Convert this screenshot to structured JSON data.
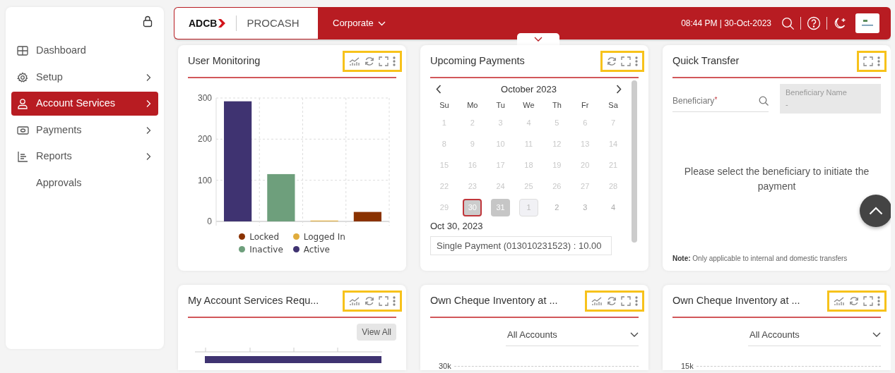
{
  "sidebar": {
    "items": [
      {
        "label": "Dashboard",
        "selected": false,
        "has_submenu": false
      },
      {
        "label": "Setup",
        "selected": false,
        "has_submenu": true
      },
      {
        "label": "Account Services",
        "selected": true,
        "has_submenu": true
      },
      {
        "label": "Payments",
        "selected": false,
        "has_submenu": true
      },
      {
        "label": "Reports",
        "selected": false,
        "has_submenu": true
      },
      {
        "label": "Approvals",
        "selected": false,
        "has_submenu": false
      }
    ]
  },
  "header": {
    "logo": "ADCB",
    "product": "PROCASH",
    "entity": "Corporate",
    "datetime": "08:44 PM | 30-Oct-2023"
  },
  "cards": [
    {
      "kind": "user_monitoring",
      "title": "User Monitoring",
      "highlighted": true,
      "chart_data": {
        "type": "bar",
        "stacked": true,
        "ylim": [
          0,
          300
        ],
        "yticks": [
          0,
          100,
          200,
          300
        ],
        "series": [
          {
            "name": "Locked",
            "color": "#8a3200",
            "values": [
              null,
              null,
              null,
              23
            ]
          },
          {
            "name": "Logged In",
            "color": "#e0ac3c",
            "values": [
              null,
              null,
              2,
              null
            ]
          },
          {
            "name": "Inactive",
            "color": "#6e9f7c",
            "values": [
              null,
              115,
              null,
              null
            ]
          },
          {
            "name": "Active",
            "color": "#3f3371",
            "values": [
              292,
              null,
              null,
              null
            ]
          }
        ]
      }
    },
    {
      "kind": "calendar",
      "title": "Upcoming Payments",
      "highlighted": true,
      "month": "October 2023",
      "weekdays": [
        "Su",
        "Mo",
        "Tu",
        "We",
        "Th",
        "Fr",
        "Sa"
      ],
      "days": [
        {
          "label": "1",
          "disabled": true,
          "selected": false,
          "marked": false,
          "focused": false
        },
        {
          "label": "2",
          "disabled": true,
          "selected": false,
          "marked": false,
          "focused": false
        },
        {
          "label": "3",
          "disabled": true,
          "selected": false,
          "marked": false,
          "focused": false
        },
        {
          "label": "4",
          "disabled": true,
          "selected": false,
          "marked": false,
          "focused": false
        },
        {
          "label": "5",
          "disabled": true,
          "selected": false,
          "marked": false,
          "focused": false
        },
        {
          "label": "6",
          "disabled": true,
          "selected": false,
          "marked": false,
          "focused": false
        },
        {
          "label": "7",
          "disabled": true,
          "selected": false,
          "marked": false,
          "focused": false
        },
        {
          "label": "8",
          "disabled": true,
          "selected": false,
          "marked": false,
          "focused": false
        },
        {
          "label": "9",
          "disabled": true,
          "selected": false,
          "marked": false,
          "focused": false
        },
        {
          "label": "10",
          "disabled": true,
          "selected": false,
          "marked": false,
          "focused": false
        },
        {
          "label": "11",
          "disabled": true,
          "selected": false,
          "marked": false,
          "focused": false
        },
        {
          "label": "12",
          "disabled": true,
          "selected": false,
          "marked": false,
          "focused": false
        },
        {
          "label": "13",
          "disabled": true,
          "selected": false,
          "marked": false,
          "focused": false
        },
        {
          "label": "14",
          "disabled": true,
          "selected": false,
          "marked": false,
          "focused": false
        },
        {
          "label": "15",
          "disabled": true,
          "selected": false,
          "marked": false,
          "focused": false
        },
        {
          "label": "16",
          "disabled": true,
          "selected": false,
          "marked": false,
          "focused": false
        },
        {
          "label": "17",
          "disabled": true,
          "selected": false,
          "marked": false,
          "focused": false
        },
        {
          "label": "18",
          "disabled": true,
          "selected": false,
          "marked": false,
          "focused": false
        },
        {
          "label": "19",
          "disabled": true,
          "selected": false,
          "marked": false,
          "focused": false
        },
        {
          "label": "20",
          "disabled": true,
          "selected": false,
          "marked": false,
          "focused": false
        },
        {
          "label": "21",
          "disabled": true,
          "selected": false,
          "marked": false,
          "focused": false
        },
        {
          "label": "22",
          "disabled": true,
          "selected": false,
          "marked": false,
          "focused": false
        },
        {
          "label": "23",
          "disabled": true,
          "selected": false,
          "marked": false,
          "focused": false
        },
        {
          "label": "24",
          "disabled": true,
          "selected": false,
          "marked": false,
          "focused": false
        },
        {
          "label": "25",
          "disabled": true,
          "selected": false,
          "marked": false,
          "focused": false
        },
        {
          "label": "26",
          "disabled": true,
          "selected": false,
          "marked": false,
          "focused": false
        },
        {
          "label": "27",
          "disabled": true,
          "selected": false,
          "marked": false,
          "focused": false
        },
        {
          "label": "28",
          "disabled": true,
          "selected": false,
          "marked": false,
          "focused": false
        },
        {
          "label": "29",
          "disabled": true,
          "selected": false,
          "marked": false,
          "focused": false
        },
        {
          "label": "30",
          "disabled": false,
          "selected": true,
          "marked": false,
          "focused": false
        },
        {
          "label": "31",
          "disabled": false,
          "selected": false,
          "marked": true,
          "focused": false
        },
        {
          "label": "1",
          "disabled": false,
          "selected": false,
          "marked": false,
          "focused": true
        },
        {
          "label": "2",
          "disabled": false,
          "selected": false,
          "marked": false,
          "focused": false
        },
        {
          "label": "3",
          "disabled": false,
          "selected": false,
          "marked": false,
          "focused": false
        },
        {
          "label": "4",
          "disabled": false,
          "selected": false,
          "marked": false,
          "focused": false
        }
      ],
      "date_heading": "Oct 30, 2023",
      "payments": [
        "Single Payment (013010231523) : 10.00"
      ]
    },
    {
      "kind": "transfer",
      "title": "Quick Transfer",
      "highlighted": true,
      "beneficiary": {
        "placeholder": "Beneficiary",
        "required_mark": "*"
      },
      "beneficiary_name": {
        "label": "Beneficiary Name",
        "value": "-"
      },
      "message": "Please select the beneficiary to initiate the payment",
      "note_label": "Note:",
      "note": "Only applicable to internal and domestic transfers"
    },
    {
      "kind": "requests",
      "title": "My Account Services Requ...",
      "highlighted": true,
      "view_all": "View All"
    },
    {
      "kind": "inventory",
      "title": "Own Cheque Inventory at ...",
      "highlighted": true,
      "account_filter": "All Accounts",
      "top_tick": "30k"
    },
    {
      "kind": "inventory",
      "title": "Own Cheque Inventory at ...",
      "highlighted": true,
      "account_filter": "All Accounts",
      "top_tick": "15k"
    }
  ]
}
